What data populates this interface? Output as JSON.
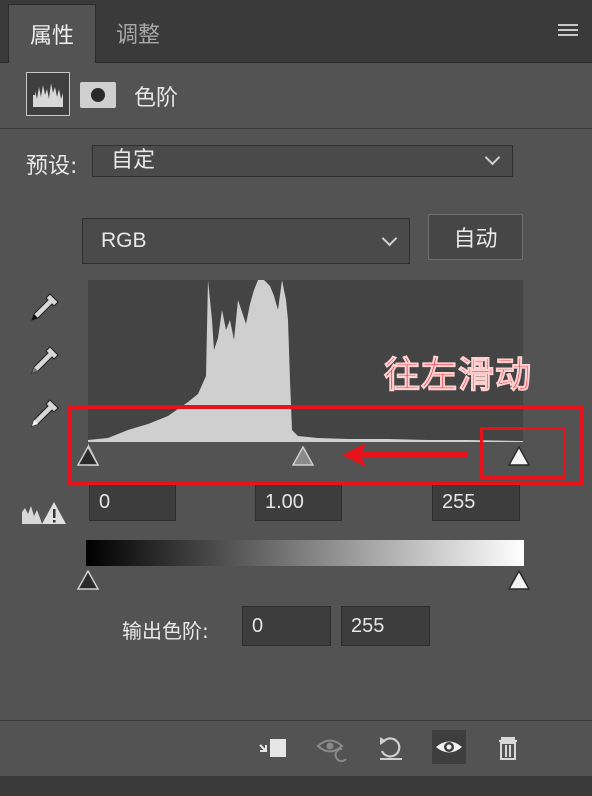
{
  "tabs": [
    {
      "label": "属性",
      "active": true
    },
    {
      "label": "调整",
      "active": false
    }
  ],
  "header": {
    "title": "色阶",
    "icons": [
      "levels-histogram-icon",
      "layer-mask-icon"
    ]
  },
  "preset": {
    "label": "预设:",
    "value": "自定"
  },
  "channel": {
    "value": "RGB",
    "auto_label": "自动"
  },
  "eyedroppers": [
    "black-point-eyedropper-icon",
    "gray-point-eyedropper-icon",
    "white-point-eyedropper-icon"
  ],
  "input_levels": {
    "black": "0",
    "gamma": "1.00",
    "white": "255"
  },
  "output_levels": {
    "label": "输出色阶:",
    "black": "0",
    "white": "255"
  },
  "annotation": {
    "text": "往左滑动",
    "color": "#e8131a"
  },
  "toolbar_icons": [
    "clip-to-layer-icon",
    "view-previous-state-icon",
    "reset-icon",
    "visibility-eye-icon",
    "delete-trash-icon"
  ],
  "colors": {
    "panel_bg": "#535353",
    "tab_bg": "#3a3a3a",
    "annotation_red": "#e8131a"
  }
}
